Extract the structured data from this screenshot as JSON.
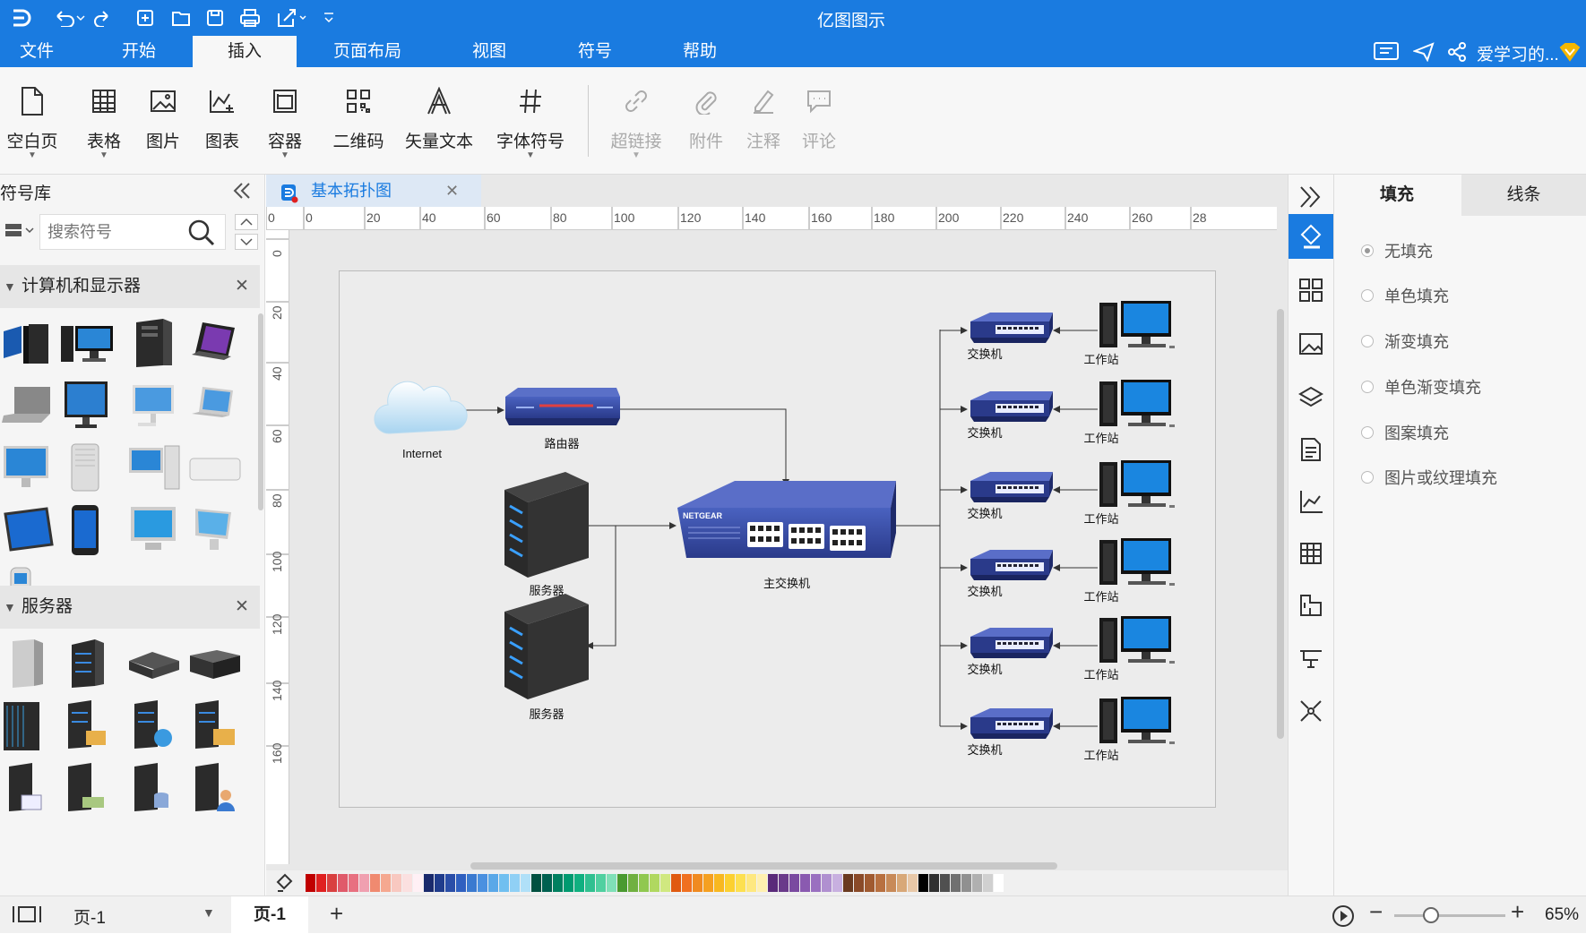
{
  "app": {
    "title": "亿图图示"
  },
  "menu": {
    "items": [
      "文件",
      "开始",
      "插入",
      "页面布局",
      "视图",
      "符号",
      "帮助"
    ],
    "active": "插入",
    "user": "爱学习的..."
  },
  "ribbon": {
    "blank_page": "空白页",
    "table": "表格",
    "picture": "图片",
    "chart": "图表",
    "container": "容器",
    "qrcode": "二维码",
    "vector_text": "矢量文本",
    "font_symbol": "字体符号",
    "hyperlink": "超链接",
    "attachment": "附件",
    "note": "注释",
    "comment": "评论"
  },
  "library": {
    "title": "符号库",
    "search_placeholder": "搜索符号",
    "cat1": "计算机和显示器",
    "cat2": "服务器"
  },
  "document": {
    "tab_name": "基本拓扑图"
  },
  "ruler": {
    "h": [
      "0",
      "0",
      "20",
      "40",
      "60",
      "80",
      "100",
      "120",
      "140",
      "160",
      "180",
      "200",
      "220",
      "240",
      "260",
      "28"
    ],
    "v": [
      "0",
      "20",
      "40",
      "60",
      "80",
      "100",
      "120",
      "140",
      "160"
    ]
  },
  "diagram": {
    "internet": "Internet",
    "router": "路由器",
    "server1": "服务器",
    "server2": "服务器",
    "main_switch": "主交换机",
    "switches": [
      "交换机",
      "交换机",
      "交换机",
      "交换机",
      "交换机",
      "交换机"
    ],
    "workstations": [
      "工作站",
      "工作站",
      "工作站",
      "工作站",
      "工作站",
      "工作站"
    ]
  },
  "palette": {
    "colors": [
      "#c00000",
      "#e02020",
      "#d94040",
      "#e05a6a",
      "#e87080",
      "#f0a0b0",
      "#f08a70",
      "#f5a890",
      "#f8c8c0",
      "#fbe0e0",
      "#fff0f5",
      "#1a2a6c",
      "#203c8c",
      "#2a4ea8",
      "#2f60c0",
      "#3a7ad0",
      "#4a90e0",
      "#5aa8e8",
      "#70bff0",
      "#90d0f5",
      "#b0e0f8",
      "#005040",
      "#006050",
      "#008060",
      "#009a70",
      "#10b080",
      "#30c090",
      "#50d0a0",
      "#80e0b8",
      "#4a9a30",
      "#70b040",
      "#90c850",
      "#b0d860",
      "#d0e880",
      "#e05a10",
      "#f07020",
      "#f08a20",
      "#f5a020",
      "#f8b820",
      "#fcd030",
      "#fde050",
      "#fee880",
      "#fff0b0",
      "#5a2a7a",
      "#6a3a8a",
      "#7a4aa0",
      "#8a5ab0",
      "#9a70c0",
      "#b090d0",
      "#c8b0e0",
      "#6a3a20",
      "#8a4a28",
      "#a05a30",
      "#b87040",
      "#c88a58",
      "#d8a878",
      "#e8c8a8",
      "#000000",
      "#303030",
      "#505050",
      "#707070",
      "#909090",
      "#b0b0b0",
      "#d0d0d0",
      "#ffffff"
    ]
  },
  "right_panel": {
    "tab_fill": "填充",
    "tab_line": "线条",
    "options": [
      "无填充",
      "单色填充",
      "渐变填充",
      "单色渐变填充",
      "图案填充",
      "图片或纹理填充"
    ]
  },
  "status": {
    "page_list_name": "页-1",
    "current_page": "页-1",
    "zoom": "65%",
    "zoom_level": 0.65
  }
}
